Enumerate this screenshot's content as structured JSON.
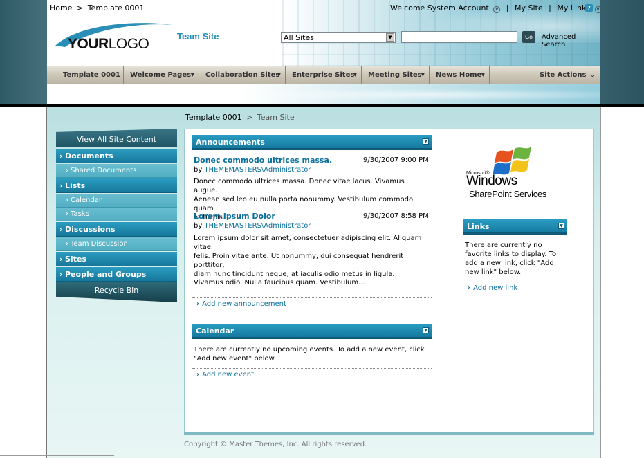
{
  "header": {
    "breadcrumb": {
      "home": "Home",
      "separator": ">",
      "current": "Template 0001"
    },
    "logo": {
      "your": "YOUR",
      "logo": "LOGO"
    },
    "site_title": "Team Site",
    "user_links": {
      "welcome": "Welcome System Account",
      "my_site": "My Site",
      "my_links": "My Links",
      "separator": "|"
    },
    "search": {
      "scope_value": "All Sites",
      "input_value": "",
      "go_label": "Go",
      "advanced_label": "Advanced Search"
    }
  },
  "nav": {
    "items": [
      {
        "label": "Template 0001",
        "dropdown": false
      },
      {
        "label": "Welcome Pages",
        "dropdown": true
      },
      {
        "label": "Collaboration Sites",
        "dropdown": true
      },
      {
        "label": "Enterprise Sites",
        "dropdown": true
      },
      {
        "label": "Meeting Sites",
        "dropdown": true
      },
      {
        "label": "News Home",
        "dropdown": true
      }
    ],
    "site_actions": "Site Actions"
  },
  "page_breadcrumb": {
    "root": "Template 0001",
    "separator": ">",
    "current": "Team Site"
  },
  "quicklaunch": {
    "view_all": "View All Site Content",
    "documents": "Documents",
    "shared_documents": "Shared Documents",
    "lists": "Lists",
    "calendar": "Calendar",
    "tasks": "Tasks",
    "discussions": "Discussions",
    "team_discussion": "Team Discussion",
    "sites": "Sites",
    "people_groups": "People and Groups",
    "recycle_bin": "Recycle Bin"
  },
  "announcements": {
    "title": "Announcements",
    "items": [
      {
        "title": "Donec commodo ultrices massa.",
        "date": "9/30/2007 9:00 PM",
        "by": "by",
        "author": "THEMEMASTERS\\Administrator",
        "body": [
          "Donec commodo ultrices massa. Donec vitae lacus. Vivamus augue.",
          "Aenean sed leo eu nulla porta nonummy. Vestibulum commodo quam",
          "et turpis."
        ]
      },
      {
        "title": "Lorem Ipsum Dolor",
        "date": "9/30/2007 8:58 PM",
        "by": "by",
        "author": "THEMEMASTERS\\Administrator",
        "body": [
          "Lorem ipsum dolor sit amet, consectetuer adipiscing elit. Aliquam vitae",
          "felis. Proin vitae ante. Ut nonummy, dui consequat hendrerit porttitor,",
          "diam nunc tincidunt neque, at iaculis odio metus in ligula."
        ],
        "body2": "Vivamus odio. Nulla faucibus quam. Vestibulum..."
      }
    ],
    "add_label": "Add new announcement"
  },
  "calendar": {
    "title": "Calendar",
    "body": [
      "There are currently no upcoming events. To add a new event, click",
      "\"Add new event\" below."
    ],
    "add_label": "Add new event"
  },
  "sp_logo": {
    "microsoft": "Microsoft®",
    "windows": "Windows",
    "services": "SharePoint Services"
  },
  "links": {
    "title": "Links",
    "body": [
      "There are currently no",
      "favorite links to display. To",
      "add a new link, click \"Add",
      "new link\" below."
    ],
    "add_label": "Add new link"
  },
  "footer": {
    "copyright": "Copyright © Master Themes, Inc. All rights reserved."
  },
  "colors": {
    "accent": "#1a86ad",
    "nav_bg": "#cfc9bb",
    "link": "#0b6f9c"
  },
  "icons": {
    "help": "help-icon",
    "dropdown": "chevron-down-icon",
    "bullet": "arrow-right-icon"
  }
}
